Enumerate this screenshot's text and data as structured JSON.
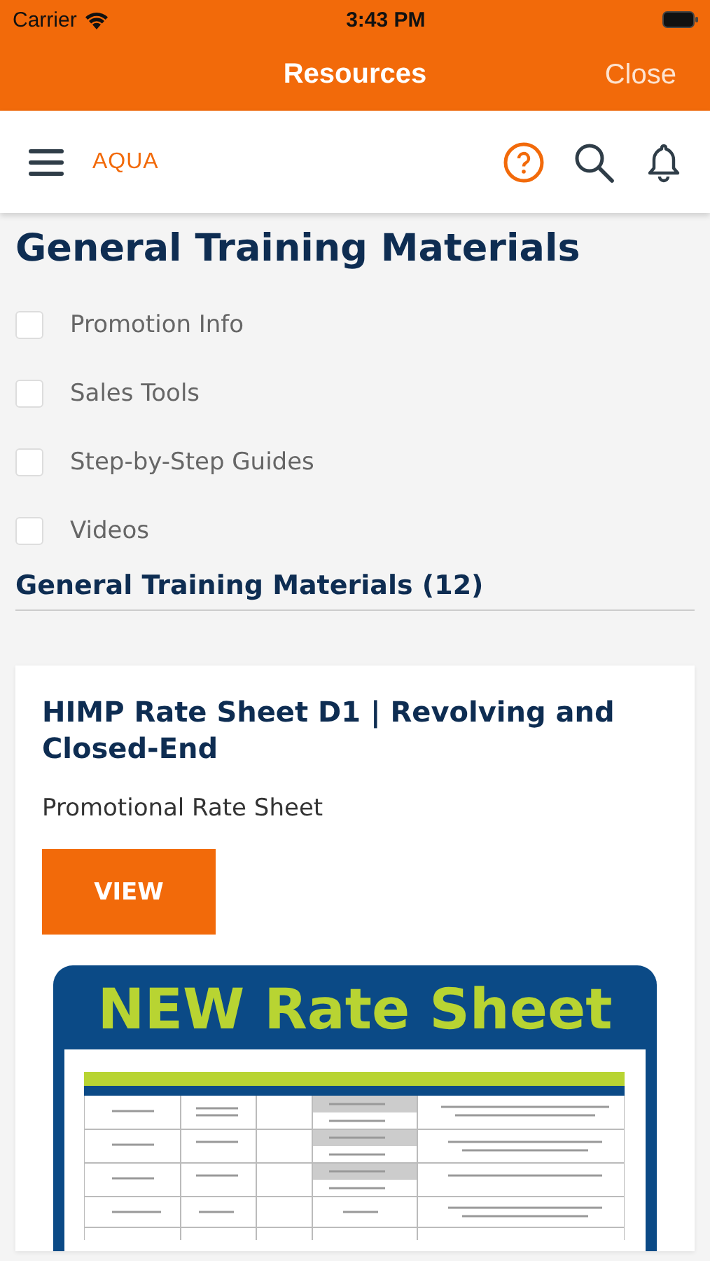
{
  "status_bar": {
    "carrier": "Carrier",
    "time": "3:43 PM"
  },
  "nav_bar": {
    "title": "Resources",
    "close": "Close"
  },
  "header": {
    "logo": "AQUA"
  },
  "section_title": "General Training Materials",
  "filters": [
    {
      "label": "Promotion Info",
      "checked": false
    },
    {
      "label": "Sales Tools",
      "checked": false
    },
    {
      "label": "Step-by-Step Guides",
      "checked": false
    },
    {
      "label": "Videos",
      "checked": false
    }
  ],
  "results_heading": "General Training Materials (12)",
  "cards": [
    {
      "title": "HIMP Rate Sheet D1 | Revolving and Closed-End",
      "subtitle": "Promotional Rate Sheet",
      "button": "VIEW",
      "preview": {
        "headline": "NEW Rate Sheet"
      }
    }
  ]
}
